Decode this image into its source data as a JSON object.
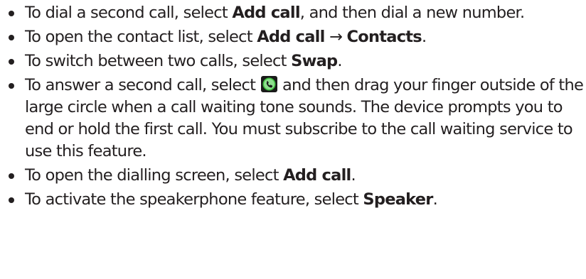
{
  "items": [
    {
      "t1": "To dial a second call, select ",
      "b1": "Add call",
      "t2": ", and then dial a new number."
    },
    {
      "t1": "To open the contact list, select ",
      "b1": "Add call",
      "arrow": " → ",
      "b2": "Contacts",
      "t2": "."
    },
    {
      "t1": "To switch between two calls, select ",
      "b1": "Swap",
      "t2": "."
    },
    {
      "t1": "To answer a second call, select ",
      "icon": "phone-answer-icon",
      "t2": " and then drag your finger outside of the large circle when a call waiting tone sounds. The device prompts you to end or hold the first call. You must subscribe to the call waiting service to use this feature."
    },
    {
      "t1": "To open the dialling screen, select ",
      "b1": "Add call",
      "t2": "."
    },
    {
      "t1": "To activate the speakerphone feature, select ",
      "b1": "Speaker",
      "t2": "."
    }
  ],
  "colors": {
    "text": "#231f20",
    "icon_background": "#1a1a1a",
    "icon_ring": "#3fbf3f",
    "icon_fill": "#8ee08e"
  }
}
